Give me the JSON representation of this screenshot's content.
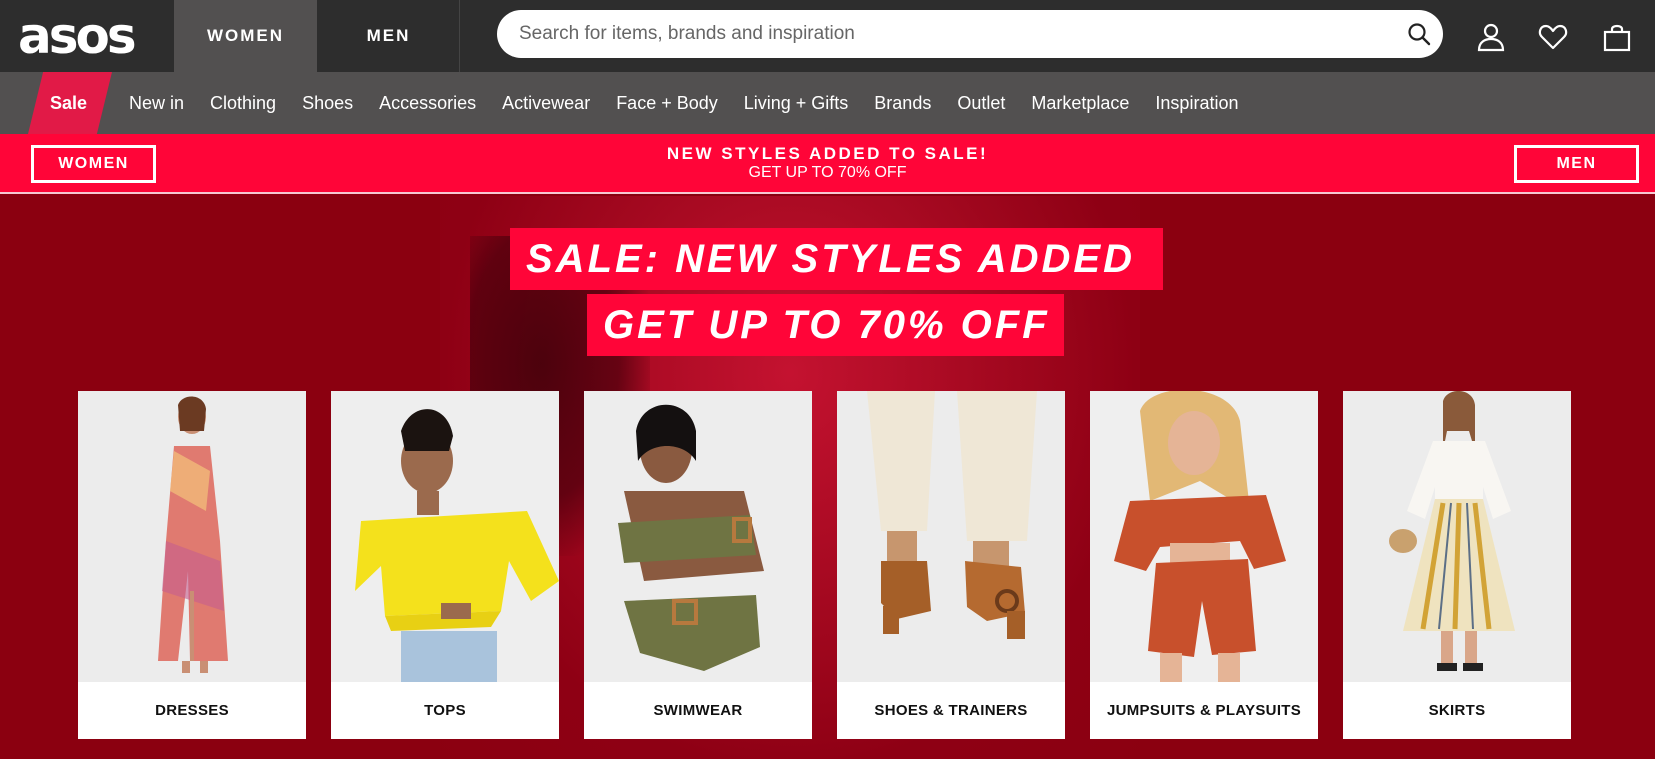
{
  "header": {
    "logo_text": "asos",
    "tabs": [
      {
        "label": "WOMEN"
      },
      {
        "label": "MEN"
      }
    ],
    "search_placeholder": "Search for items, brands and inspiration",
    "icons": [
      "search-icon",
      "account-icon",
      "heart-icon",
      "bag-icon"
    ]
  },
  "nav": {
    "sale_label": "Sale",
    "items": [
      {
        "label": "New in"
      },
      {
        "label": "Clothing"
      },
      {
        "label": "Shoes"
      },
      {
        "label": "Accessories"
      },
      {
        "label": "Activewear"
      },
      {
        "label": "Face + Body"
      },
      {
        "label": "Living + Gifts"
      },
      {
        "label": "Brands"
      },
      {
        "label": "Outlet"
      },
      {
        "label": "Marketplace"
      },
      {
        "label": "Inspiration"
      }
    ]
  },
  "promo": {
    "women_label": "WOMEN",
    "men_label": "MEN",
    "headline": "NEW STYLES ADDED TO SALE!",
    "subline": "GET UP TO 70% OFF"
  },
  "hero": {
    "line1": "SALE: NEW STYLES ADDED",
    "line2": "GET UP TO 70% OFF"
  },
  "categories": [
    {
      "label": "DRESSES"
    },
    {
      "label": "TOPS"
    },
    {
      "label": "SWIMWEAR"
    },
    {
      "label": "SHOES & TRAINERS"
    },
    {
      "label": "JUMPSUITS & PLAYSUITS"
    },
    {
      "label": "SKIRTS"
    }
  ],
  "colors": {
    "topbar": "#2d2d2d",
    "navbar": "#525050",
    "sale_pink": "#e11a47",
    "promo_red": "#ff0538",
    "hero_bg": "#8b0010"
  }
}
